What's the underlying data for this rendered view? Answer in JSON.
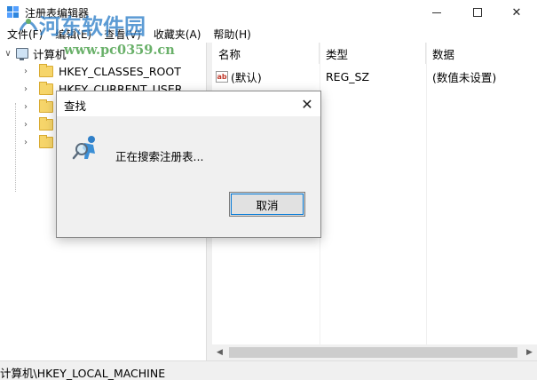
{
  "window": {
    "title": "注册表编辑器",
    "minimize_glyph": "—",
    "maximize_glyph": "☐",
    "close_glyph": "✕"
  },
  "menu": [
    "文件(F)",
    "编辑(E)",
    "查看(V)",
    "收藏夹(A)",
    "帮助(H)"
  ],
  "tree": {
    "root": "计算机",
    "items": [
      "HKEY_CLASSES_ROOT",
      "HKEY_CURRENT_USER",
      "",
      "",
      ""
    ]
  },
  "list": {
    "headers": {
      "name": "名称",
      "type": "类型",
      "data": "数据"
    },
    "rows": [
      {
        "icon": "string-value-icon",
        "icon_text": "ab",
        "name": "(默认)",
        "type": "REG_SZ",
        "data": "(数值未设置)"
      }
    ]
  },
  "statusbar": {
    "path": "计算机\\HKEY_LOCAL_MACHINE"
  },
  "dialog": {
    "title": "查找",
    "message": "正在搜索注册表...",
    "cancel_label": "取消",
    "close_glyph": "✕"
  },
  "watermark": {
    "title": "河东软件园",
    "url": "www.pc0359.cn"
  },
  "colors": {
    "accent": "#0078d7",
    "folder": "#f6d56a",
    "watermark_blue": "#2f7fc8",
    "watermark_green": "#3f9a3f"
  }
}
